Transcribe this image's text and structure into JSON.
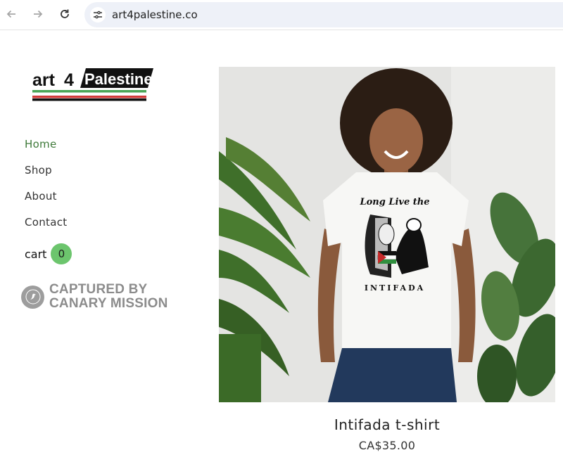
{
  "browser": {
    "url": "art4palestine.co",
    "back_icon": "arrow-left-icon",
    "forward_icon": "arrow-right-icon",
    "reload_icon": "reload-icon",
    "site_info_icon": "tune-icon"
  },
  "logo": {
    "text_art": "art",
    "text_4": "4",
    "text_name": "Palestine"
  },
  "nav": {
    "items": [
      {
        "label": "Home",
        "active": true
      },
      {
        "label": "Shop",
        "active": false
      },
      {
        "label": "About",
        "active": false
      },
      {
        "label": "Contact",
        "active": false
      }
    ],
    "cart_label": "cart",
    "cart_count": "0"
  },
  "watermark": {
    "line1": "CAPTURED BY",
    "line2": "CANARY MISSION"
  },
  "product": {
    "image_shirt_text_top": "Long Live the",
    "image_shirt_text_bottom": "INTIFADA",
    "title": "Intifada t-shirt",
    "price": "CA$35.00"
  },
  "colors": {
    "accent_green": "#6cc56d",
    "nav_active": "#3f7a3a"
  }
}
